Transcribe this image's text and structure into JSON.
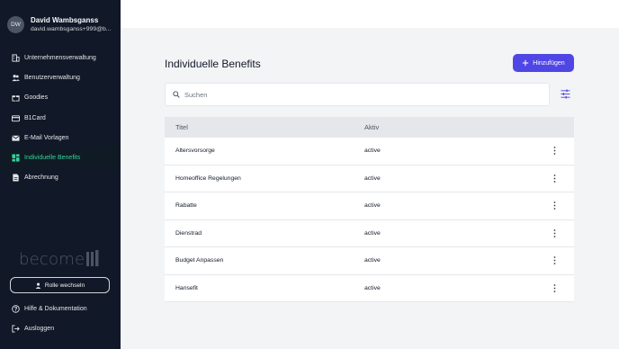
{
  "user": {
    "initials": "DW",
    "name": "David Wambsganss",
    "email": "david.wambsganss+999@b..."
  },
  "sidebar": {
    "items": [
      {
        "label": "Unternehmensverwaltung",
        "icon": "building-icon"
      },
      {
        "label": "Benutzerverwaltung",
        "icon": "users-icon"
      },
      {
        "label": "Goodies",
        "icon": "gift-icon"
      },
      {
        "label": "B1Card",
        "icon": "card-icon"
      },
      {
        "label": "E-Mail Vorlagen",
        "icon": "mail-icon"
      },
      {
        "label": "Individuelle Benefits",
        "icon": "grid-icon",
        "active": true
      },
      {
        "label": "Abrechnung",
        "icon": "document-icon"
      }
    ],
    "logo": "become",
    "role_button": "Rolle wechseln",
    "help": "Hilfe & Dokumentation",
    "logout": "Ausloggen"
  },
  "main": {
    "title": "Individuelle Benefits",
    "add_button": "Hinzufügen",
    "search_placeholder": "Suchen",
    "table": {
      "headers": [
        "Titel",
        "Aktiv"
      ],
      "rows": [
        {
          "title": "Altersvorsorge",
          "status": "active"
        },
        {
          "title": "Homeoffice Regelungen",
          "status": "active"
        },
        {
          "title": "Rabatte",
          "status": "active"
        },
        {
          "title": "Dienstrad",
          "status": "active"
        },
        {
          "title": "Budget Anpassen",
          "status": "active"
        },
        {
          "title": "Hansefit",
          "status": "active"
        }
      ]
    }
  },
  "colors": {
    "sidebar_bg": "#111827",
    "accent": "#4f46e5",
    "active_nav": "#34d399"
  }
}
